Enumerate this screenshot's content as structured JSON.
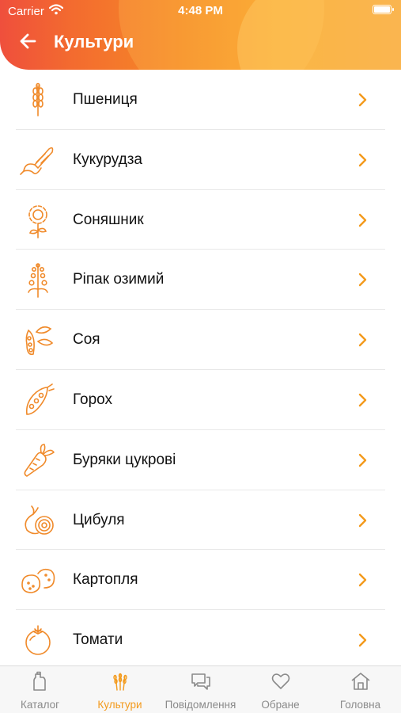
{
  "status_bar": {
    "carrier": "Carrier",
    "time": "4:48 PM"
  },
  "header": {
    "title": "Культури"
  },
  "crops": [
    {
      "label": "Пшениця",
      "icon": "wheat-icon"
    },
    {
      "label": "Кукурудза",
      "icon": "corn-icon"
    },
    {
      "label": "Соняшник",
      "icon": "sunflower-icon"
    },
    {
      "label": "Ріпак озимий",
      "icon": "rapeseed-icon"
    },
    {
      "label": "Соя",
      "icon": "soy-icon"
    },
    {
      "label": "Горох",
      "icon": "pea-icon"
    },
    {
      "label": "Буряки цукрові",
      "icon": "sugar-beet-icon"
    },
    {
      "label": "Цибуля",
      "icon": "onion-icon"
    },
    {
      "label": "Картопля",
      "icon": "potato-icon"
    },
    {
      "label": "Томати",
      "icon": "tomato-icon"
    }
  ],
  "tabs": [
    {
      "label": "Каталог",
      "icon": "catalog-icon",
      "active": false
    },
    {
      "label": "Культури",
      "icon": "wheat-icon",
      "active": true
    },
    {
      "label": "Повідомлення",
      "icon": "messages-icon",
      "active": false
    },
    {
      "label": "Обране",
      "icon": "heart-icon",
      "active": false
    },
    {
      "label": "Головна",
      "icon": "home-icon",
      "active": false
    }
  ],
  "colors": {
    "accent": "#f39a1c",
    "header_start": "#ef4f3c",
    "header_end": "#f9a52a",
    "icon": "#f08a2a",
    "tab_inactive": "#8a8a8a"
  }
}
